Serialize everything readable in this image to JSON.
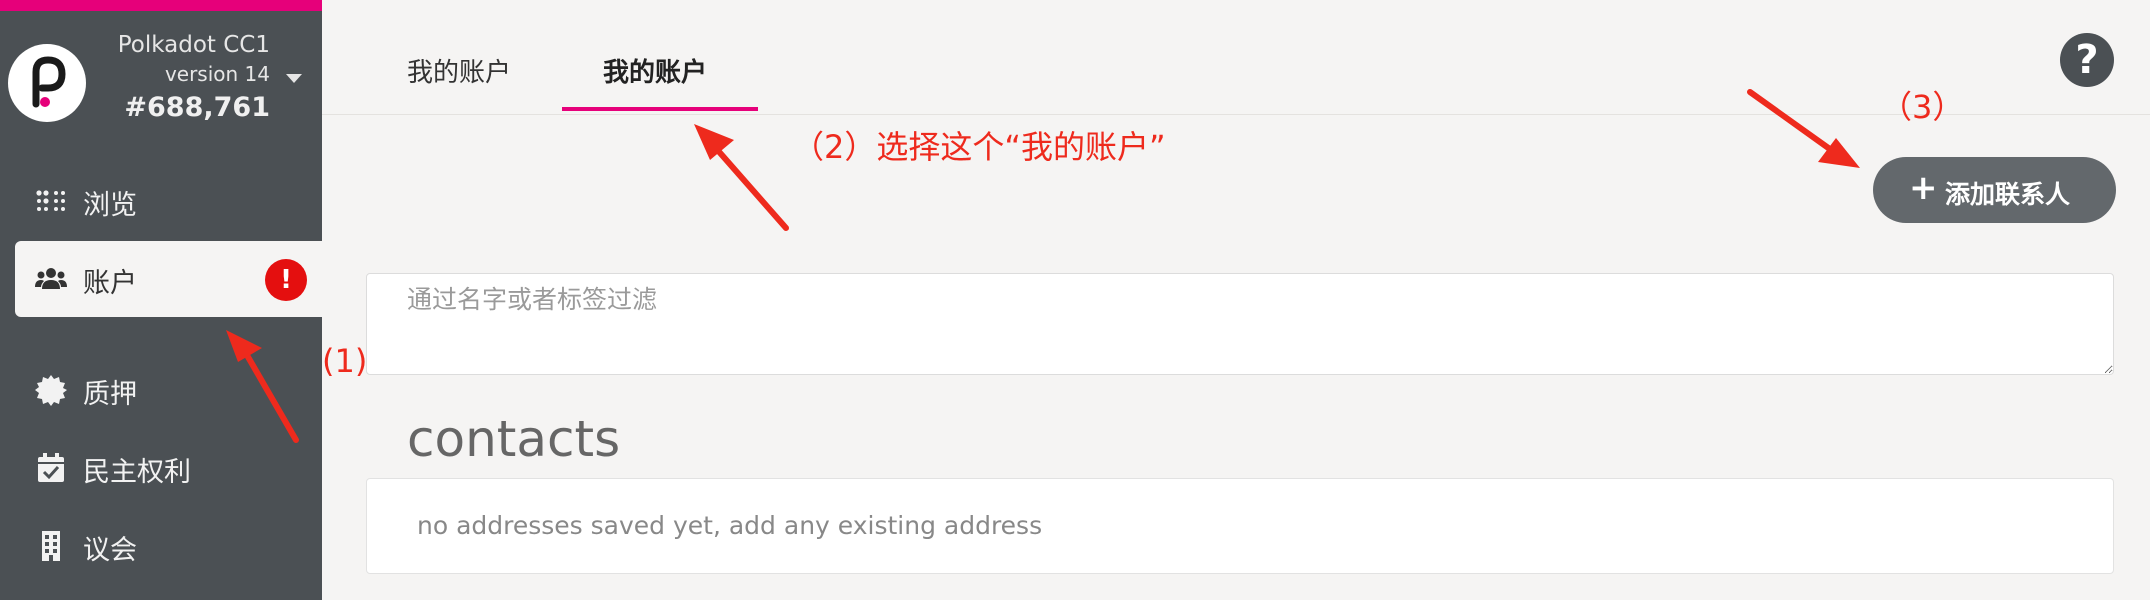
{
  "sidebar": {
    "chain_name": "Polkadot CC1",
    "version": "version 14",
    "block": "#688,761",
    "items": [
      {
        "label": "浏览",
        "icon": "dots-grid-icon"
      },
      {
        "label": "账户",
        "icon": "users-icon",
        "active": true,
        "badge": "!"
      },
      {
        "label": "质押",
        "icon": "certificate-icon"
      },
      {
        "label": "民主权利",
        "icon": "calendar-check-icon"
      },
      {
        "label": "议会",
        "icon": "building-icon"
      }
    ]
  },
  "tabs": [
    {
      "label": "我的账户"
    },
    {
      "label": "我的账户",
      "active": true
    }
  ],
  "help_icon": "question-circle-icon",
  "add_contact": {
    "label": "添加联系人",
    "icon": "plus-icon"
  },
  "filter": {
    "placeholder": "通过名字或者标签过滤",
    "value": ""
  },
  "contacts": {
    "title": "contacts",
    "empty_text": "no addresses saved yet, add any existing address"
  },
  "annotations": {
    "step1": "(1)",
    "step2": "（2）选择这个“我的账户”",
    "step3": "（3）"
  },
  "colors": {
    "brand_pink": "#e6007a",
    "sidebar_bg": "#4b5054",
    "badge_red": "#e40f0f",
    "annotation_red": "#ee2a1d"
  }
}
